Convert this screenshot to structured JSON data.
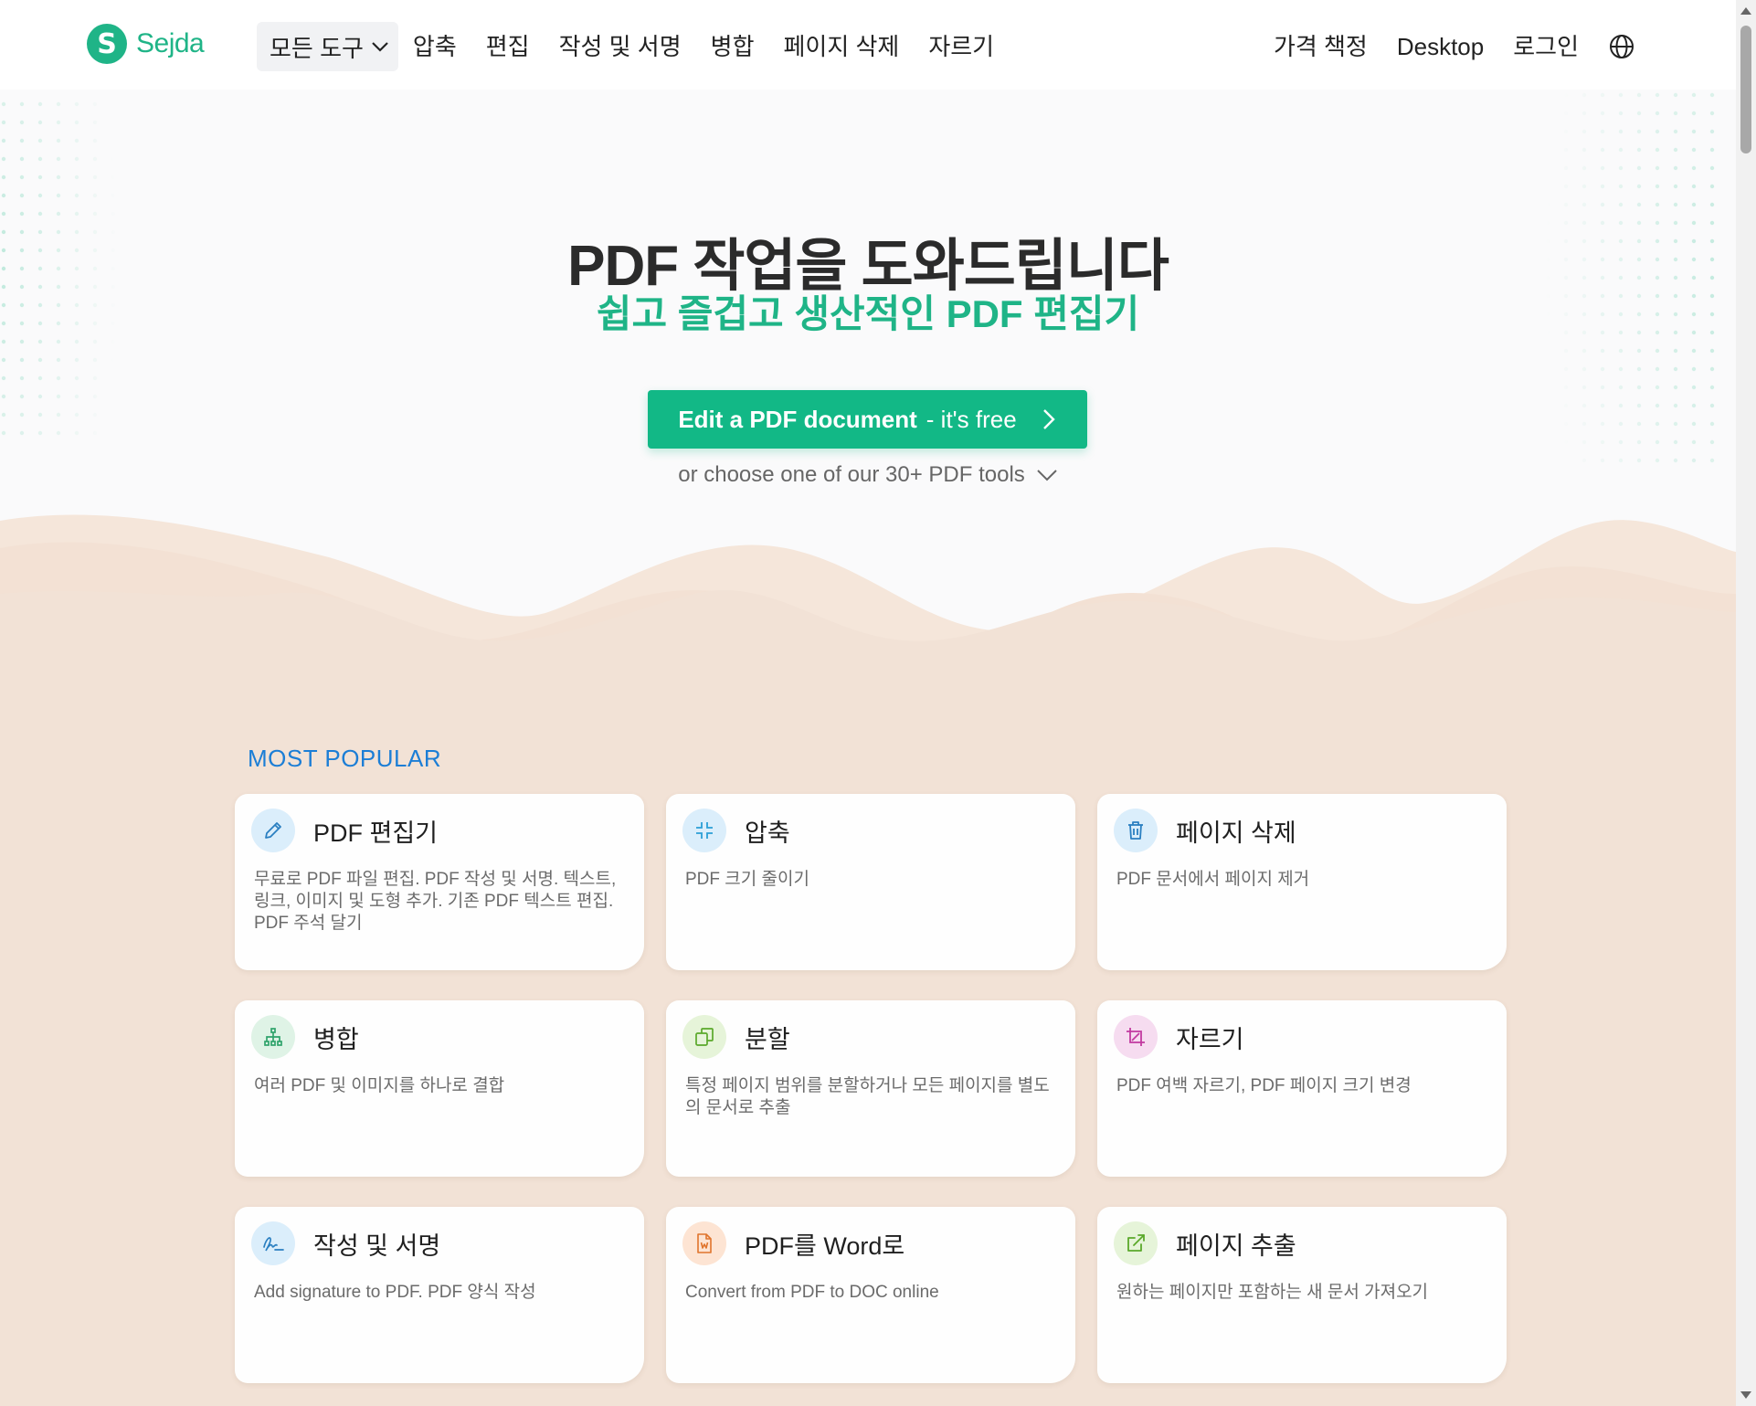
{
  "header": {
    "logo_letter": "S",
    "logo_text": "Sejda",
    "nav_dropdown_label": "모든 도구",
    "nav_items": [
      "압축",
      "편집",
      "작성 및 서명",
      "병합",
      "페이지 삭제",
      "자르기"
    ],
    "right_items": [
      "가격 책정",
      "Desktop",
      "로그인"
    ],
    "globe_icon": "globe-icon"
  },
  "hero": {
    "title": "PDF 작업을 도와드립니다",
    "subtitle": "쉽고 즐겁고 생산적인 PDF 편집기",
    "cta_strong": "Edit a PDF document",
    "cta_light": "- it's free",
    "choose_text": "or choose one of our 30+ PDF tools"
  },
  "tools": {
    "section_title": "MOST POPULAR",
    "cards": [
      {
        "title": "PDF 편집기",
        "desc": "무료로 PDF 파일 편집. PDF 작성 및 서명. 텍스트, 링크, 이미지 및 도형 추가. 기존 PDF 텍스트 편집. PDF 주석 달기",
        "icon": "pencil-icon",
        "icon_bg": "#dbeefb",
        "icon_color": "#2a7fc1"
      },
      {
        "title": "압축",
        "desc": "PDF 크기 줄이기",
        "icon": "compress-icon",
        "icon_bg": "#dbeefb",
        "icon_color": "#2a9fd6"
      },
      {
        "title": "페이지 삭제",
        "desc": "PDF 문서에서 페이지 제거",
        "icon": "trash-icon",
        "icon_bg": "#dbeefb",
        "icon_color": "#2a7fc1"
      },
      {
        "title": "병합",
        "desc": "여러 PDF 및 이미지를 하나로 결합",
        "icon": "merge-icon",
        "icon_bg": "#dff3e6",
        "icon_color": "#2fa36b"
      },
      {
        "title": "분할",
        "desc": "특정 페이지 범위를 분할하거나 모든 페이지를 별도의 문서로 추출",
        "icon": "split-icon",
        "icon_bg": "#e6f4d9",
        "icon_color": "#5aa82a"
      },
      {
        "title": "자르기",
        "desc": "PDF 여백 자르기, PDF 페이지 크기 변경",
        "icon": "crop-icon",
        "icon_bg": "#f6dcf0",
        "icon_color": "#c23aa0"
      },
      {
        "title": "작성 및 서명",
        "desc": "Add signature to PDF. PDF 양식 작성",
        "icon": "signature-icon",
        "icon_bg": "#dbeefb",
        "icon_color": "#2a7fc1"
      },
      {
        "title": "PDF를 Word로",
        "desc": "Convert from PDF to DOC online",
        "icon": "word-file-icon",
        "icon_bg": "#fde4d3",
        "icon_color": "#e0742c"
      },
      {
        "title": "페이지 추출",
        "desc": "원하는 페이지만 포함하는 새 문서 가져오기",
        "icon": "extract-icon",
        "icon_bg": "#e6f4d9",
        "icon_color": "#5aa82a"
      }
    ]
  }
}
